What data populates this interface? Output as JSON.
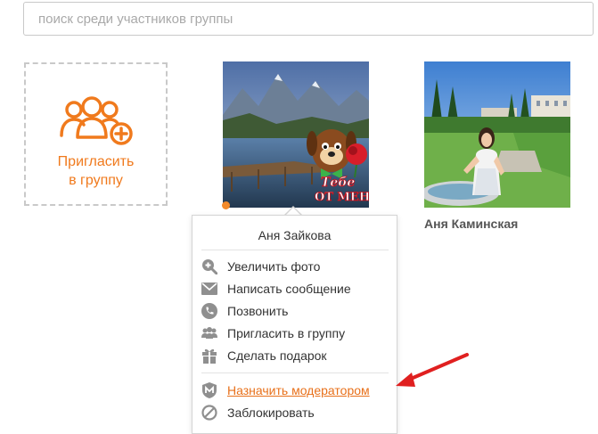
{
  "search": {
    "placeholder": "поиск среди участников группы"
  },
  "invite": {
    "line1": "Пригласить",
    "line2": "в группу"
  },
  "members": [
    {
      "name": "Аня Зайкова",
      "online": true,
      "sticker_text_line1": "Тебе",
      "sticker_text_line2": "ОТ МЕНЯ"
    },
    {
      "name": "Аня Каминская"
    }
  ],
  "context_menu": {
    "title": "Аня Зайкова",
    "items": [
      {
        "label": "Увеличить фото",
        "icon": "zoom-in-icon"
      },
      {
        "label": "Написать сообщение",
        "icon": "envelope-icon"
      },
      {
        "label": "Позвонить",
        "icon": "phone-icon"
      },
      {
        "label": "Пригласить в группу",
        "icon": "group-icon"
      },
      {
        "label": "Сделать подарок",
        "icon": "gift-icon"
      },
      {
        "label": "Назначить модератором",
        "icon": "moderator-shield-icon",
        "highlighted": true
      },
      {
        "label": "Заблокировать",
        "icon": "block-icon"
      }
    ]
  },
  "colors": {
    "accent": "#f07a1d",
    "highlight_link": "#e8701a",
    "annotation_arrow": "#e02020"
  }
}
